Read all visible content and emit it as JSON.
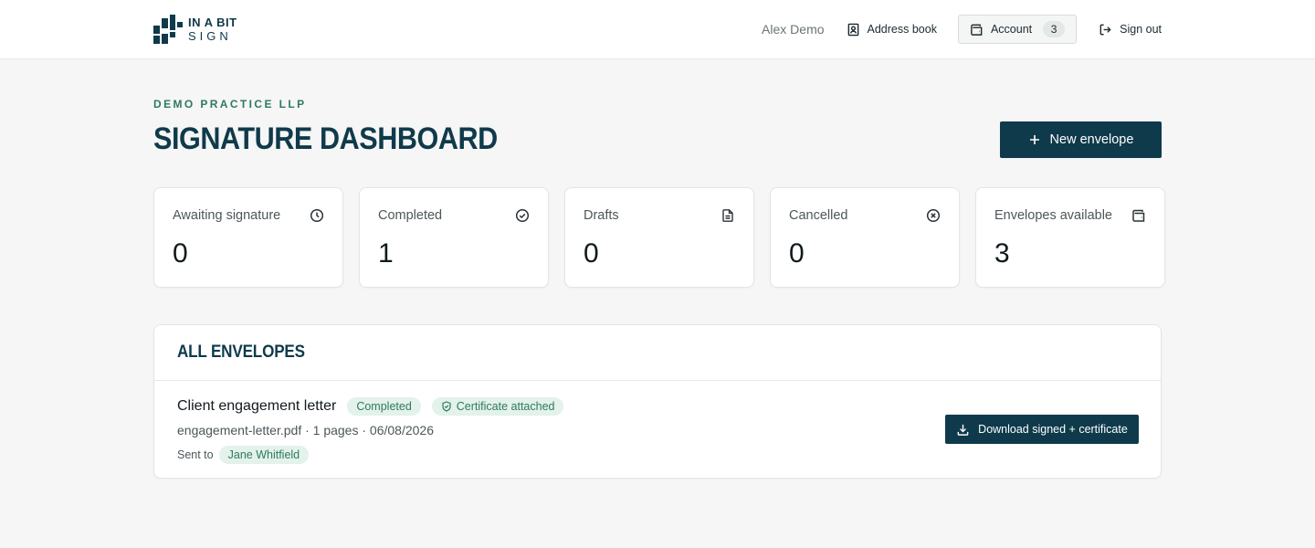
{
  "header": {
    "logo": {
      "line1": "IN A BIT",
      "line2": "SIGN"
    },
    "user_name": "Alex Demo",
    "address_book_label": "Address book",
    "account_label": "Account",
    "account_count": "3",
    "sign_out_label": "Sign out"
  },
  "page": {
    "eyebrow": "DEMO PRACTICE LLP",
    "title": "SIGNATURE DASHBOARD",
    "new_envelope_label": "New envelope"
  },
  "stats": [
    {
      "label": "Awaiting signature",
      "value": "0",
      "icon": "clock-icon"
    },
    {
      "label": "Completed",
      "value": "1",
      "icon": "check-circle-icon"
    },
    {
      "label": "Drafts",
      "value": "0",
      "icon": "document-icon"
    },
    {
      "label": "Cancelled",
      "value": "0",
      "icon": "x-circle-icon"
    },
    {
      "label": "Envelopes available",
      "value": "3",
      "icon": "wallet-icon"
    }
  ],
  "envelopes": {
    "heading": "ALL ENVELOPES",
    "items": [
      {
        "name": "Client engagement letter",
        "status": "Completed",
        "certificate": "Certificate attached",
        "meta": "engagement-letter.pdf · 1 pages · 06/08/2026",
        "sent_to_label": "Sent to",
        "recipient": "Jane Whitfield",
        "download_label": "Download signed + certificate"
      }
    ]
  },
  "colors": {
    "brand": "#0f3a4b",
    "accent_green": "#2f7a5e",
    "pill_bg": "#e3f2ea",
    "page_bg": "#f5f6f5"
  }
}
